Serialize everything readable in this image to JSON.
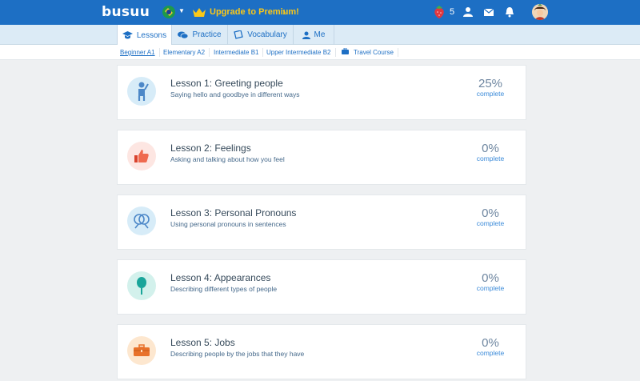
{
  "header": {
    "logo": "busuu",
    "upgrade_label": "Upgrade to Premium!",
    "strawberry_count": "5",
    "icons": [
      "strawberry-icon",
      "user-icon",
      "mail-icon",
      "bell-icon",
      "avatar"
    ]
  },
  "tabs": [
    {
      "label": "Lessons",
      "icon": "graduation-cap-icon",
      "active": true
    },
    {
      "label": "Practice",
      "icon": "chat-bubbles-icon",
      "active": false
    },
    {
      "label": "Vocabulary",
      "icon": "note-icon",
      "active": false
    },
    {
      "label": "Me",
      "icon": "user-icon",
      "active": false
    }
  ],
  "levels": [
    {
      "label": "Beginner A1",
      "active": true
    },
    {
      "label": "Elementary A2",
      "active": false
    },
    {
      "label": "Intermediate B1",
      "active": false
    },
    {
      "label": "Upper Intermediate B2",
      "active": false
    },
    {
      "label": "Travel Course",
      "active": false,
      "icon": "suitcase-icon"
    }
  ],
  "lessons": [
    {
      "title": "Lesson 1: Greeting people",
      "subtitle": "Saying hello and goodbye in different ways",
      "percent": "25%",
      "status": "complete",
      "icon": "waving-person-icon",
      "color": "#d7ecf8"
    },
    {
      "title": "Lesson 2: Feelings",
      "subtitle": "Asking and talking about how you feel",
      "percent": "0%",
      "status": "complete",
      "icon": "thumbs-up-icon",
      "color": "#fde6e2"
    },
    {
      "title": "Lesson 3: Personal Pronouns",
      "subtitle": "Using personal pronouns in sentences",
      "percent": "0%",
      "status": "complete",
      "icon": "people-pronouns-icon",
      "color": "#d7ecf8"
    },
    {
      "title": "Lesson 4: Appearances",
      "subtitle": "Describing different types of people",
      "percent": "0%",
      "status": "complete",
      "icon": "lollipop-icon",
      "color": "#d3f1ec"
    },
    {
      "title": "Lesson 5: Jobs",
      "subtitle": "Describing people by the jobs that they have",
      "percent": "0%",
      "status": "complete",
      "icon": "briefcase-icon",
      "color": "#fde7cf"
    }
  ],
  "colors": {
    "brand": "#1d6fc4",
    "premium": "#fbc817",
    "tab_bg": "#dcebf6"
  }
}
